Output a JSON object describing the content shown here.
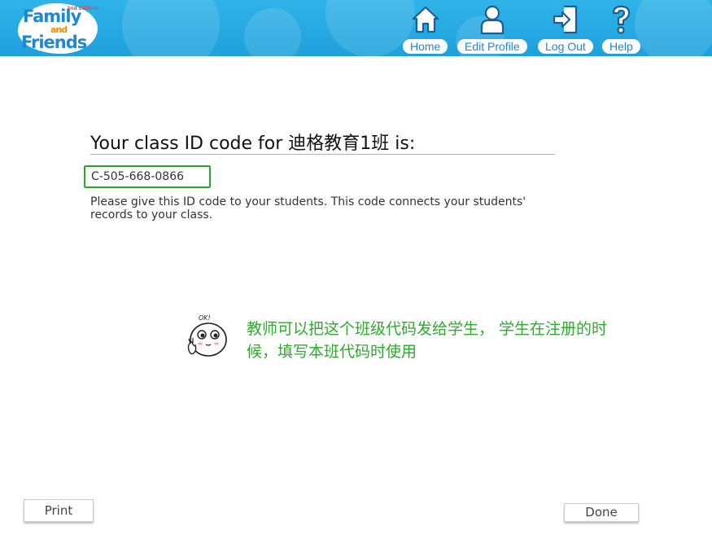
{
  "header": {
    "logo": {
      "line1": "Family",
      "line2": "and",
      "line3": "Friends",
      "edition": "2nd Edition"
    },
    "nav": [
      {
        "label": "Home",
        "icon": "home-icon"
      },
      {
        "label": "Edit Profile",
        "icon": "user-icon"
      },
      {
        "label": "Log Out",
        "icon": "logout-icon"
      },
      {
        "label": "Help",
        "icon": "help-icon"
      }
    ],
    "colors": {
      "bar": "#1fa0dc",
      "button_text": "#1e88d6"
    }
  },
  "main": {
    "title_prefix": "Your class ID code for ",
    "class_name": "迪格教育1班",
    "title_suffix": " is:",
    "class_code": "C-505-668-0866",
    "instructions": "Please give this ID code to your students. This code connects your students' records to your class."
  },
  "annotation": {
    "sticker_text": "OK!",
    "note": "教师可以把这个班级代码发给学生， 学生在注册册的时候，填写本班代码时使用",
    "note_line1": "教师可以把这个班级代码发给学生， 学生在注册的时",
    "note_line2": "候，填写本班代码时使用",
    "highlight_color": "#2ea52e"
  },
  "footer": {
    "print_label": "Print",
    "done_label": "Done"
  }
}
